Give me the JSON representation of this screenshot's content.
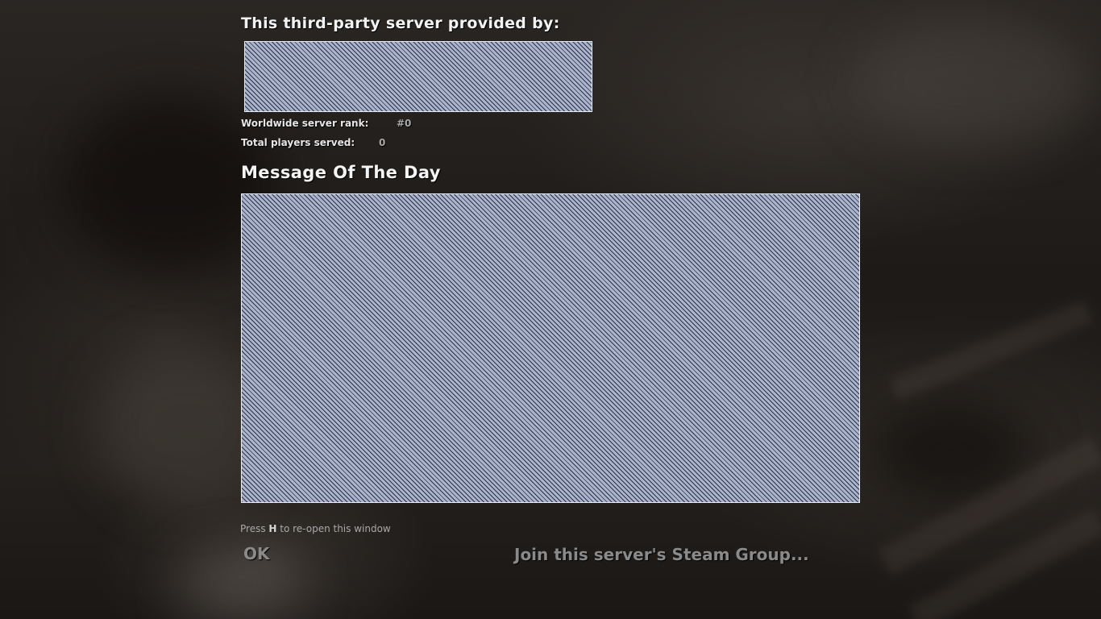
{
  "header": {
    "provided_by_label": "This third-party server provided by:"
  },
  "stats": {
    "rank_label": "Worldwide server rank:",
    "rank_value": "#0",
    "players_label": "Total players served:",
    "players_value": "0"
  },
  "motd": {
    "title": "Message Of The Day"
  },
  "footer": {
    "hint_prefix": "Press ",
    "hint_key": "H",
    "hint_suffix": " to re-open this window",
    "ok_label": "OK",
    "steam_group_label": "Join this server's Steam Group..."
  },
  "colors": {
    "hatch_light": "#aab4cf",
    "hatch_dark": "#2f3340",
    "button_text": "#8a8a8a",
    "heading_text": "#f2f2f2"
  }
}
